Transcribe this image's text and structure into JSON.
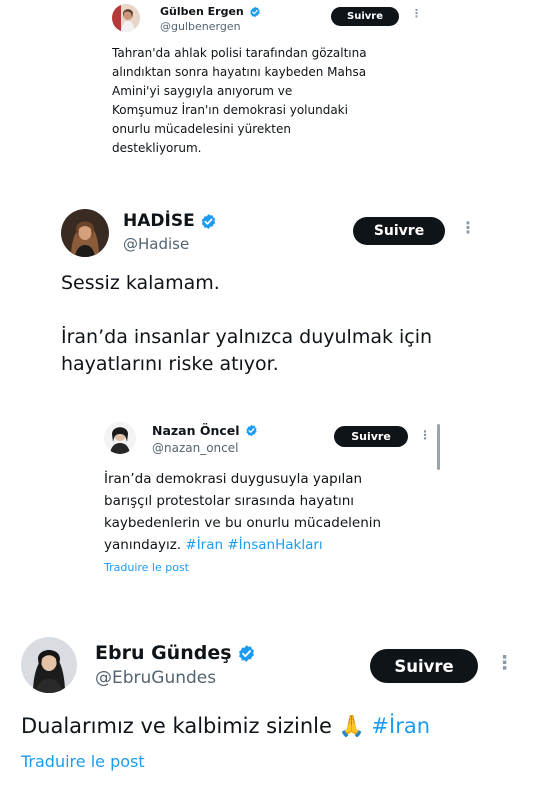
{
  "colors": {
    "accent": "#1d9bf0",
    "text": "#0f1419",
    "muted": "#536471",
    "button": "#0f1419",
    "verified": "#1d9bf0"
  },
  "tweets": [
    {
      "name": "Gülben Ergen",
      "handle": "@gulbenergen",
      "follow_label": "Suivre",
      "more_icon": "more-vertical-icon",
      "lines": [
        "Tahran'da ahlak polisi tarafından gözaltına",
        "alındıktan sonra hayatını kaybeden Mahsa",
        "Amini'yi saygıyla anıyorum ve",
        "Komşumuz İran'ın demokrasi yolundaki",
        "onurlu mücadelesini yürekten",
        "destekliyorum."
      ]
    },
    {
      "name": "HADİSE",
      "handle": "@Hadise",
      "follow_label": "Suivre",
      "more_icon": "more-vertical-icon",
      "lines": [
        "Sessiz kalamam.",
        "İran’da insanlar yalnızca duyulmak için",
        "hayatlarını riske atıyor."
      ]
    },
    {
      "name": "Nazan Öncel",
      "handle": "@nazan_oncel",
      "follow_label": "Suivre",
      "more_icon": "more-vertical-icon",
      "lines": [
        "İran’da demokrasi duygusuyla yapılan",
        "barışçıl protestolar sırasında hayatını",
        "kaybedenlerin ve bu onurlu mücadelenin",
        "yanındayız."
      ],
      "hashtags": [
        "#İran",
        "#İnsanHakları"
      ],
      "translate_label": "Traduire le post"
    },
    {
      "name": "Ebru Gündeş",
      "handle": "@EbruGundes",
      "follow_label": "Suivre",
      "more_icon": "more-vertical-icon",
      "text": "Dualarımız ve kalbimiz sizinle",
      "emoji": "🙏",
      "hashtag": "#İran",
      "translate_label": "Traduire le post"
    }
  ]
}
